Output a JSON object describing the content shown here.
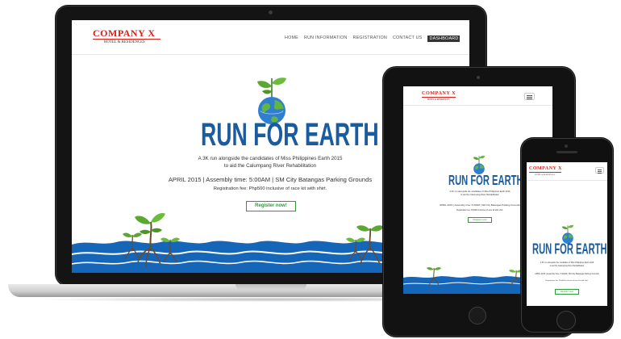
{
  "site": {
    "logo_main": "COMPANY X",
    "logo_sub": "HOTEL & RESIDENCES",
    "nav": [
      "HOME",
      "RUN INFORMATION",
      "REGISTRATION",
      "CONTACT US"
    ],
    "nav_active": "DASHBOARD",
    "hero_title": "RUN FOR EARTH",
    "tagline_line1": "A 3K run alongside the candidates of Miss Philippines Earth 2015",
    "tagline_line2": "to aid the Calumpang River Rehabilitation",
    "event_info": "APRIL 2015 | Assembly time: 5:00AM | SM City Batangas Parking Grounds",
    "fee_info": "Registration fee: Php500 inclusive of race kit with shirt.",
    "register_button": "Register now!"
  },
  "icons": {
    "globe": "earth-globe-icon",
    "sprout": "sprout-icon",
    "menu": "hamburger-menu-icon"
  },
  "colors": {
    "brand_red": "#d8201a",
    "title_blue": "#1b5c9e",
    "river_blue": "#1565b8",
    "button_green": "#2e9a3a",
    "leaf_green": "#5aa832",
    "root_brown": "#6a4a2e"
  }
}
